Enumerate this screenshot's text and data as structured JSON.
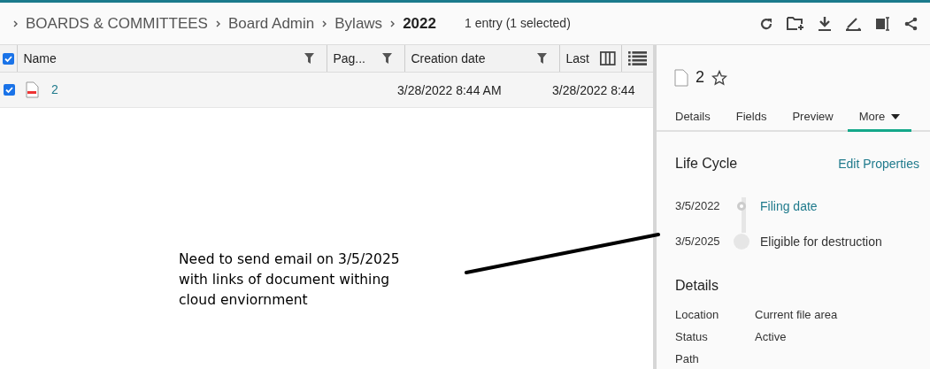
{
  "breadcrumb": [
    {
      "label": "BOARDS & COMMITTEES",
      "current": false
    },
    {
      "label": "Board Admin",
      "current": false
    },
    {
      "label": "Bylaws",
      "current": false
    },
    {
      "label": "2022",
      "current": true
    }
  ],
  "entry_count": "1 entry (1 selected)",
  "table": {
    "all_checked": true,
    "columns": [
      {
        "label": "Name",
        "filter": true
      },
      {
        "label": "Pag...",
        "filter": true
      },
      {
        "label": "Creation date",
        "filter": true
      },
      {
        "label": "Last",
        "filter": false
      }
    ],
    "rows": [
      {
        "selected": true,
        "cells": [
          "2",
          "",
          "3/28/2022 8:44 AM",
          "3/28/2022 8:44"
        ]
      }
    ]
  },
  "detail": {
    "title": "2",
    "starred": false,
    "tabs": [
      {
        "label": "Details",
        "selected": false
      },
      {
        "label": "Fields",
        "selected": false
      },
      {
        "label": "Preview",
        "selected": false
      },
      {
        "label": "More",
        "selected": true
      }
    ],
    "life_cycle": {
      "heading": "Life Cycle",
      "action": "Edit Properties",
      "events": [
        {
          "date": "3/5/2022",
          "label": "Filing date",
          "reached": true
        },
        {
          "date": "3/5/2025",
          "label": "Eligible for destruction",
          "reached": false
        }
      ]
    },
    "details": {
      "heading": "Details",
      "fields": [
        {
          "label": "Location",
          "value": "Current file area"
        },
        {
          "label": "Status",
          "value": "Active"
        },
        {
          "label": "Path"
        }
      ]
    }
  },
  "annotation": {
    "lines": [
      "Need to send email on 3/5/2025",
      "with links of document withing",
      "cloud enviornment"
    ]
  }
}
